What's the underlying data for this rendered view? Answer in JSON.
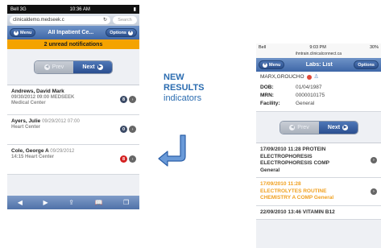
{
  "left_phone": {
    "status": {
      "carrier": "Bell 3G",
      "time": "10:36 AM",
      "battery": "▮"
    },
    "browser": {
      "url": "clinicaldemo.medseek.c",
      "search_placeholder": "Search"
    },
    "nav": {
      "menu_label": "Menu",
      "title": "All Inpatient Ce...",
      "options_label": "Options"
    },
    "notification": "2 unread notifications",
    "pager": {
      "prev_label": "Prev",
      "next_label": "Next"
    },
    "patients": [
      {
        "name": "Andrews, David Mark",
        "date": "",
        "sub": "09/30/2012 09:00 MEDSEEK",
        "sub2": "Medical Center",
        "badge": "8",
        "badge_color": "#3b4a66"
      },
      {
        "name": "Ayers, Julie",
        "date": "09/29/2012 07:00",
        "sub": "Heart Center",
        "sub2": "",
        "badge": "0",
        "badge_color": "#3b4a66"
      },
      {
        "name": "Cole, George A",
        "date": "09/29/2012",
        "sub": "14:15 Heart Center",
        "sub2": "",
        "badge": "8",
        "badge_color": "#d42020"
      }
    ],
    "toolbar": {
      "back": "◀",
      "forward": "▶",
      "share": "⇪",
      "bookmarks": "📖",
      "tabs": "❐"
    }
  },
  "callout": {
    "line1": "NEW",
    "line2": "RESULTS",
    "line3": "indicators"
  },
  "right_phone": {
    "status": {
      "carrier": "Bell",
      "time": "9:03 PM",
      "battery": "30%"
    },
    "url": "ihntrain.clinicalconnect.ca",
    "nav": {
      "menu_label": "Menu",
      "title": "Labs: List",
      "options_label": "Options"
    },
    "patient_name": "MARX,GROUCHO",
    "info": [
      {
        "key": "DOB:",
        "value": "01/04/1987"
      },
      {
        "key": "MRN:",
        "value": "0000010175"
      },
      {
        "key": "Facility:",
        "value": "General"
      }
    ],
    "pager": {
      "prev_label": "Prev",
      "next_label": "Next"
    },
    "labs": [
      {
        "lines": [
          "17/09/2010 11:28 PROTEIN",
          "ELECTROPHORESIS",
          "ELECTROPHORESIS COMP",
          "General"
        ],
        "is_new": false
      },
      {
        "lines": [
          "17/09/2010 11:28",
          "ELECTROLYTES ROUTINE",
          "CHEMISTRY A COMP General"
        ],
        "is_new": true
      },
      {
        "lines": [
          "22/09/2010 13:46 VITAMIN B12"
        ],
        "is_new": false
      }
    ]
  },
  "colors": {
    "accent": "#2b6cb0",
    "notification": "#f4a300",
    "new_result": "#f0a020"
  }
}
